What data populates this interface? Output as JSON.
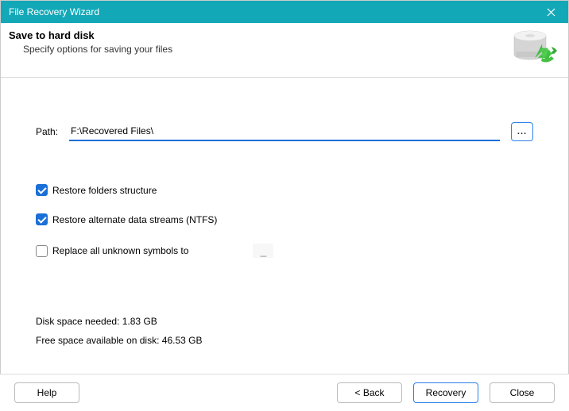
{
  "title": "File Recovery Wizard",
  "header": {
    "heading": "Save to hard disk",
    "subtext": "Specify options for saving your files"
  },
  "path": {
    "label": "Path:",
    "value": "F:\\Recovered Files\\",
    "browse_label": "..."
  },
  "options": {
    "restore_folders": {
      "label": "Restore folders structure",
      "checked": true
    },
    "restore_ads": {
      "label": "Restore alternate data streams (NTFS)",
      "checked": true
    },
    "replace_symbols": {
      "label": "Replace all unknown symbols to",
      "checked": false,
      "value": "_"
    }
  },
  "space": {
    "needed_label": "Disk space needed:",
    "needed_value": "1.83 GB",
    "free_label": "Free space available on disk:",
    "free_value": "46.53 GB"
  },
  "footer": {
    "help": "Help",
    "back": "< Back",
    "recovery": "Recovery",
    "close": "Close"
  }
}
